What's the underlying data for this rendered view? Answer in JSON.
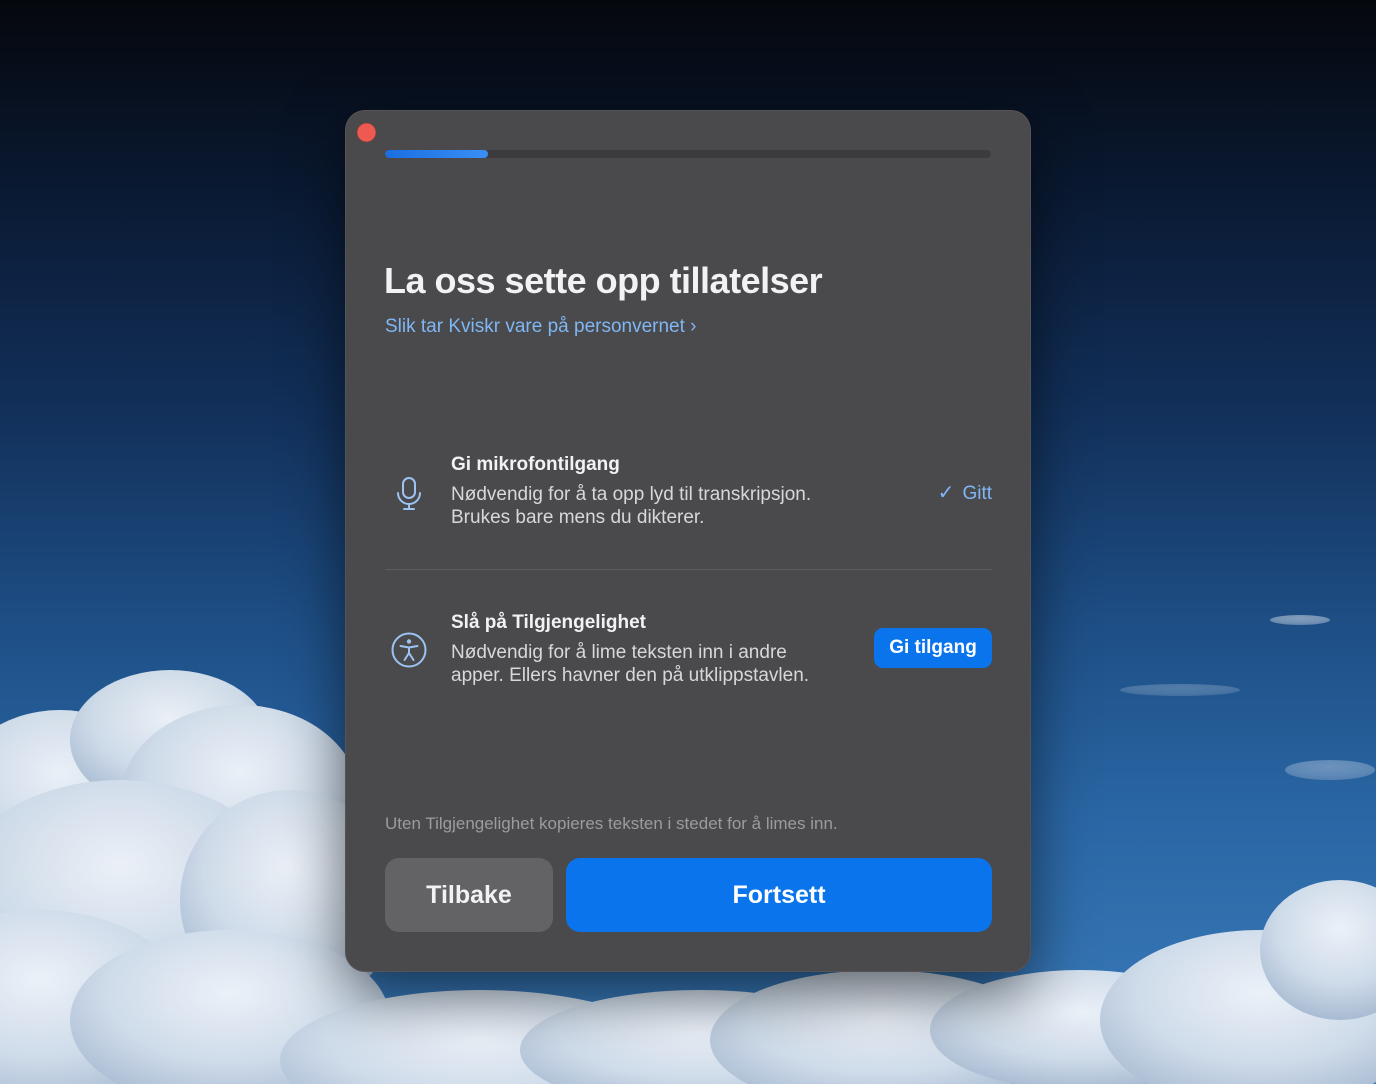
{
  "window": {
    "close_icon": "close-icon",
    "progress": 0.17
  },
  "header": {
    "title": "La oss sette opp tillatelser",
    "privacy_link": "Slik tar Kviskr vare på personvernet ›"
  },
  "permissions": [
    {
      "icon": "microphone-icon",
      "title": "Gi mikrofontilgang",
      "description_line1": "Nødvendig for å ta opp lyd til transkripsjon.",
      "description_line2": "Brukes bare mens du dikterer.",
      "status": "granted",
      "status_label": "Gitt"
    },
    {
      "icon": "accessibility-icon",
      "title": "Slå på Tilgjengelighet",
      "description_line1": "Nødvendig for å lime teksten inn i andre",
      "description_line2": "apper. Ellers havner den på utklippstavlen.",
      "status": "not-granted",
      "action_label": "Gi tilgang"
    }
  ],
  "footer": {
    "note": "Uten Tilgjengelighet kopieres teksten i stedet for å limes inn.",
    "back_label": "Tilbake",
    "continue_label": "Fortsett"
  },
  "colors": {
    "accent": "#0a74ec",
    "link": "#7fb6f4",
    "window_bg": "#4a4a4c",
    "close": "#ee5a52"
  }
}
